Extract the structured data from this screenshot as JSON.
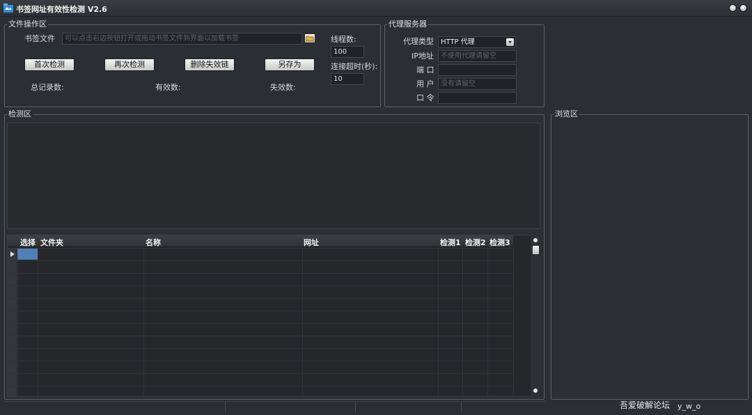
{
  "window": {
    "title": "书签网址有效性检测 V2.6"
  },
  "file_group": {
    "label": "文件操作区",
    "bookmark_label": "书签文件",
    "bookmark_placeholder": "可以点击右边按钮打开或拖动书签文件到界面以加载书签",
    "buttons": {
      "first_check": "首次检测",
      "recheck": "再次检测",
      "delete_invalid": "删除失效链",
      "save_as": "另存为"
    },
    "stats": {
      "total": "总记录数:",
      "valid": "有效数:",
      "invalid": "失效数:"
    },
    "threads_label": "线程数:",
    "threads_value": "100",
    "timeout_label": "连接超时(秒):",
    "timeout_value": "10"
  },
  "proxy_group": {
    "label": "代理服务器",
    "type_label": "代理类型",
    "type_value": "HTTP 代理",
    "ip_label": "IP地址",
    "ip_placeholder": "不使用代理请留空",
    "port_label": "端 口",
    "user_label": "用 户",
    "user_placeholder": "没有请留空",
    "password_label": "口 令"
  },
  "check_group": {
    "label": "检测区"
  },
  "browse_group": {
    "label": "浏览区"
  },
  "table": {
    "columns": [
      "选择",
      "文件夹",
      "名称",
      "网址",
      "检测1",
      "检测2",
      "检测3"
    ]
  },
  "footer": {
    "watermark": "吾爱破解论坛",
    "author": "y_w_o"
  }
}
